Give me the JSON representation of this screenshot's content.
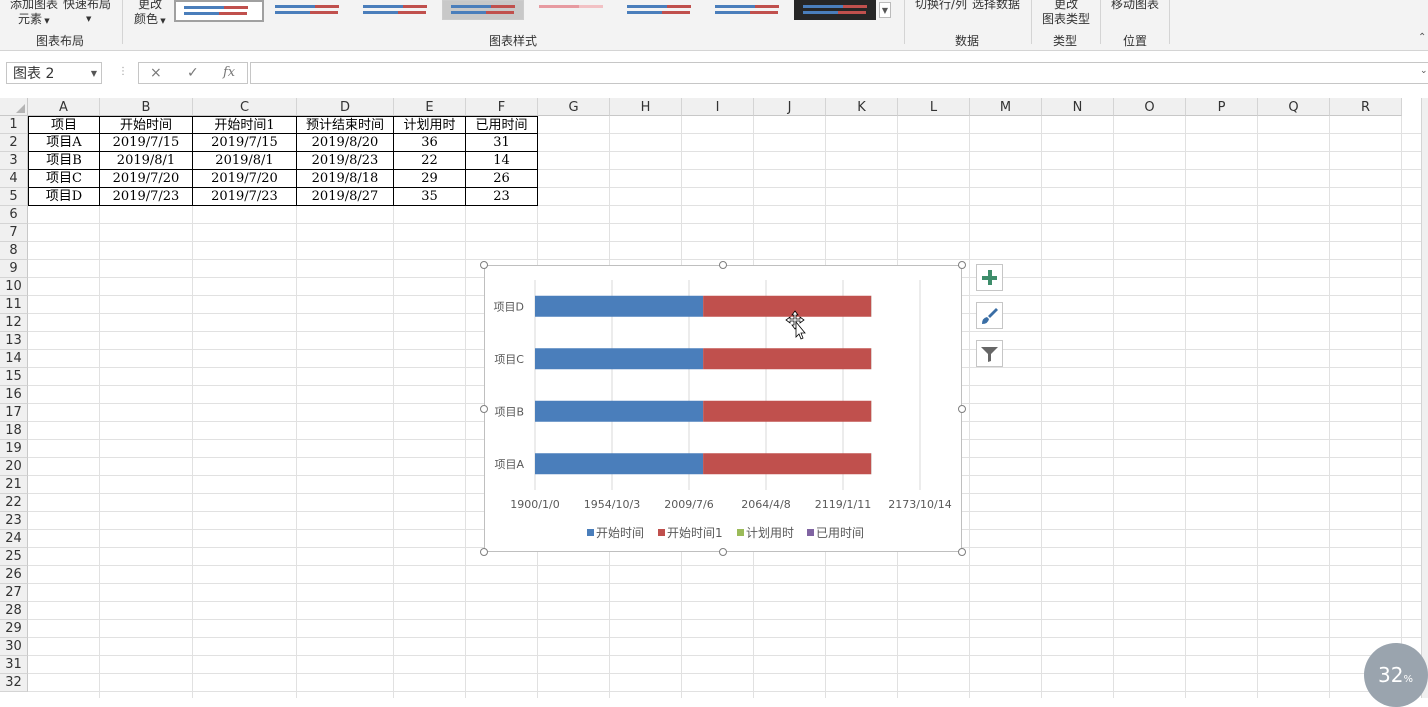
{
  "ribbon": {
    "add_element": [
      "添加图表",
      "元素"
    ],
    "quick_layout": "快速布局",
    "change_colors": [
      "更改",
      "颜色"
    ],
    "switch_row_col": "切换行/列",
    "select_data": "选择数据",
    "change_type": [
      "更改",
      "图表类型"
    ],
    "move_chart": "移动图表",
    "groups": {
      "layout": "图表布局",
      "styles": "图表样式",
      "data": "数据",
      "type": "类型",
      "location": "位置"
    }
  },
  "formula_bar": {
    "name_box": "图表 2",
    "cancel_icon": "×",
    "enter_icon": "✓",
    "fx_label": "fx",
    "value": ""
  },
  "sheet": {
    "columns": [
      "A",
      "B",
      "C",
      "D",
      "E",
      "F",
      "G",
      "H",
      "I",
      "J",
      "K",
      "L",
      "M",
      "N",
      "O",
      "P",
      "Q",
      "R"
    ],
    "rows": [
      "1",
      "2",
      "3",
      "4",
      "5",
      "6",
      "7",
      "8",
      "9",
      "10",
      "11",
      "12",
      "13",
      "14",
      "15",
      "16",
      "17",
      "18",
      "19",
      "20",
      "21",
      "22",
      "23",
      "24",
      "25",
      "26",
      "27",
      "28",
      "29",
      "30",
      "31",
      "32"
    ],
    "table": {
      "headers": [
        "项目",
        "开始时间",
        "开始时间1",
        "预计结束时间",
        "计划用时",
        "已用时间"
      ],
      "rows": [
        [
          "项目A",
          "2019/7/15",
          "2019/7/15",
          "2019/8/20",
          "36",
          "31"
        ],
        [
          "项目B",
          "2019/8/1",
          "2019/8/1",
          "2019/8/23",
          "22",
          "14"
        ],
        [
          "项目C",
          "2019/7/20",
          "2019/7/20",
          "2019/8/18",
          "29",
          "26"
        ],
        [
          "项目D",
          "2019/7/23",
          "2019/7/23",
          "2019/8/27",
          "35",
          "23"
        ]
      ]
    }
  },
  "chart_data": {
    "type": "bar",
    "orientation": "horizontal",
    "stacked": true,
    "categories": [
      "项目A",
      "项目B",
      "项目C",
      "项目D"
    ],
    "series": [
      {
        "name": "开始时间",
        "color": "#4a7ebb",
        "values": [
          43661,
          43678,
          43666,
          43669
        ]
      },
      {
        "name": "开始时间1",
        "color": "#c0504d",
        "values": [
          43661,
          43678,
          43666,
          43669
        ]
      },
      {
        "name": "计划用时",
        "color": "#9bbb59",
        "values": [
          36,
          22,
          29,
          35
        ]
      },
      {
        "name": "已用时间",
        "color": "#8064a2",
        "values": [
          31,
          14,
          26,
          23
        ]
      }
    ],
    "x_ticks": [
      "1900/1/0",
      "1954/10/3",
      "2009/7/6",
      "2064/4/8",
      "2119/1/11",
      "2173/10/14"
    ],
    "xlim": [
      0,
      100000
    ],
    "legend_position": "bottom",
    "gridlines": true
  },
  "side_buttons": [
    "chart-elements-icon",
    "chart-styles-icon",
    "chart-filter-icon"
  ],
  "status": {
    "progress": "32",
    "progress_unit": "%"
  }
}
